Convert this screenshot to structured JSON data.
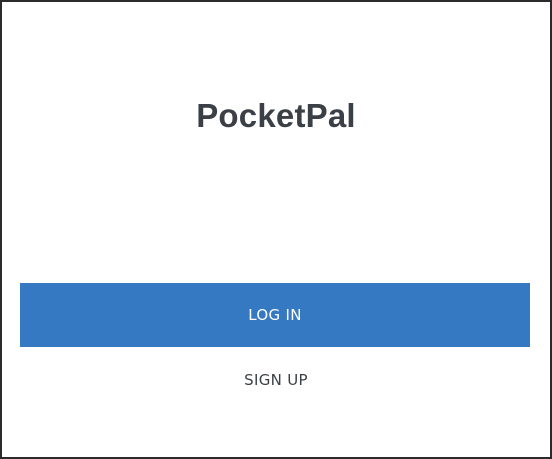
{
  "app": {
    "title": "PocketPal"
  },
  "actions": {
    "login_label": "LOG IN",
    "signup_label": "SIGN UP"
  },
  "colors": {
    "accent": "#3679c3",
    "text": "#3b4047",
    "background": "#ffffff"
  }
}
